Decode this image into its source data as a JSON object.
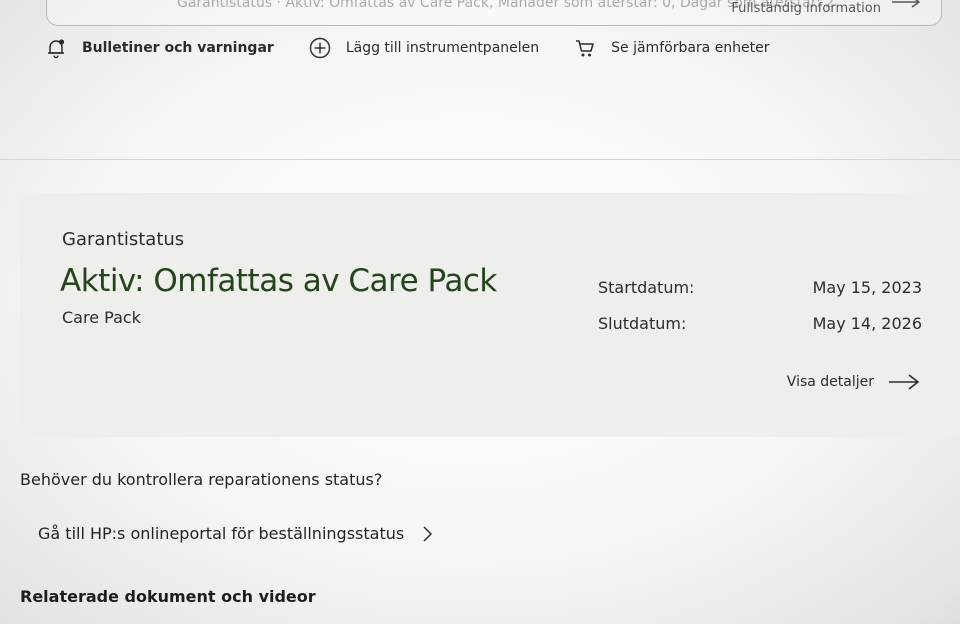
{
  "top_strip": {
    "text": "Garantistatus · Aktiv: Omfattas av Care Pack, Månader som återstår: 0, Dagar som återstår: 2",
    "link": "Fullständig information",
    "arrow_icon": "arrow-right-icon"
  },
  "actions": [
    {
      "label": "Bulletiner och varningar",
      "icon": "bell-icon"
    },
    {
      "label": "Lägg till instrumentpanelen",
      "icon": "plus-circle-icon"
    },
    {
      "label": "Se jämförbara enheter",
      "icon": "cart-icon"
    }
  ],
  "warranty": {
    "label": "Garantistatus",
    "status": "Aktiv: Omfattas av Care Pack",
    "product": "Care Pack",
    "start_label": "Startdatum:",
    "start_value": "May 15, 2023",
    "end_label": "Slutdatum:",
    "end_value": "May 14, 2026",
    "details_link": "Visa detaljer",
    "details_icon": "arrow-right-icon",
    "status_color": "#24451c"
  },
  "repair": {
    "question": "Behöver du kontrollera reparationens status?",
    "portal_link": "Gå till HP:s onlineportal för beställningsstatus",
    "portal_icon": "chevron-right-icon"
  },
  "related": {
    "heading": "Relaterade dokument och videor"
  }
}
